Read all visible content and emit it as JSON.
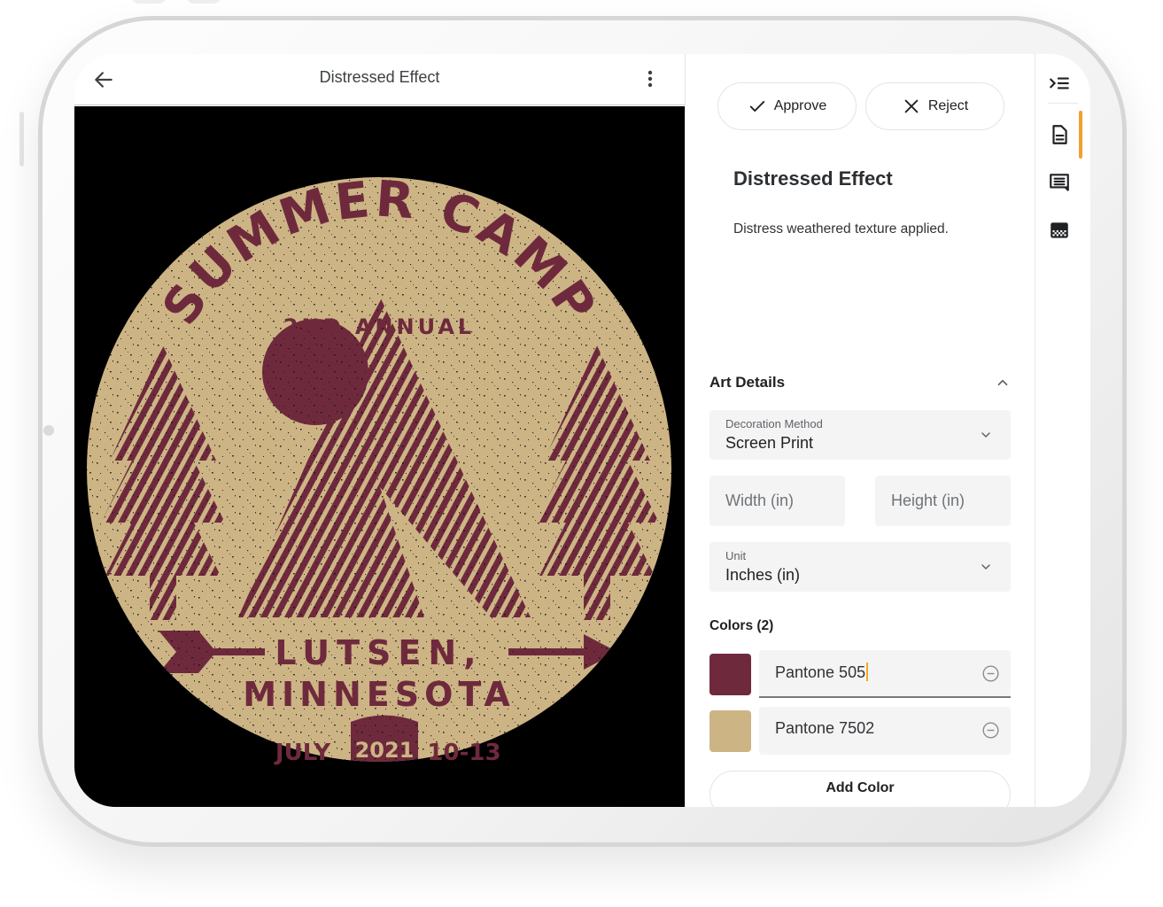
{
  "header": {
    "title": "Distressed Effect",
    "back_icon": "arrow-left-icon",
    "more_icon": "more-vertical-icon"
  },
  "artwork": {
    "alt": "Summer Camp circular badge artwork with distressed texture",
    "background": "#000000",
    "colors": {
      "primary": "#6e2a3c",
      "secondary": "#cdb485"
    },
    "text": {
      "title_arc": "SUMMER CAMP",
      "subtitle": "2ND ANNUAL",
      "line1": "LUTSEN,",
      "line2": "MINNESOTA",
      "month": "JULY",
      "year": "2021",
      "days": "10-13"
    }
  },
  "actions": {
    "approve_label": "Approve",
    "approve_icon": "check-icon",
    "reject_label": "Reject",
    "reject_icon": "close-icon"
  },
  "step": {
    "title": "Distressed Effect",
    "description": "Distress weathered texture applied."
  },
  "art_details": {
    "heading": "Art Details",
    "collapse_icon": "chevron-up-icon",
    "decoration_method": {
      "label": "Decoration Method",
      "value": "Screen Print"
    },
    "width": {
      "placeholder": "Width (in)",
      "value": ""
    },
    "height": {
      "placeholder": "Height (in)",
      "value": ""
    },
    "unit": {
      "label": "Unit",
      "value": "Inches (in)"
    },
    "colors_heading": "Colors (2)",
    "colors": [
      {
        "name": "Pantone 505",
        "swatch": "#6e2a3c",
        "focused": true
      },
      {
        "name": "Pantone 7502",
        "swatch": "#cdb485",
        "focused": false
      }
    ],
    "add_color_label": "Add Color"
  },
  "rail": {
    "items": [
      {
        "icon": "collapse-panel-icon"
      },
      {
        "icon": "document-icon",
        "active": true
      },
      {
        "icon": "comment-icon"
      },
      {
        "icon": "texture-icon"
      }
    ],
    "accent": "#f0a030"
  }
}
